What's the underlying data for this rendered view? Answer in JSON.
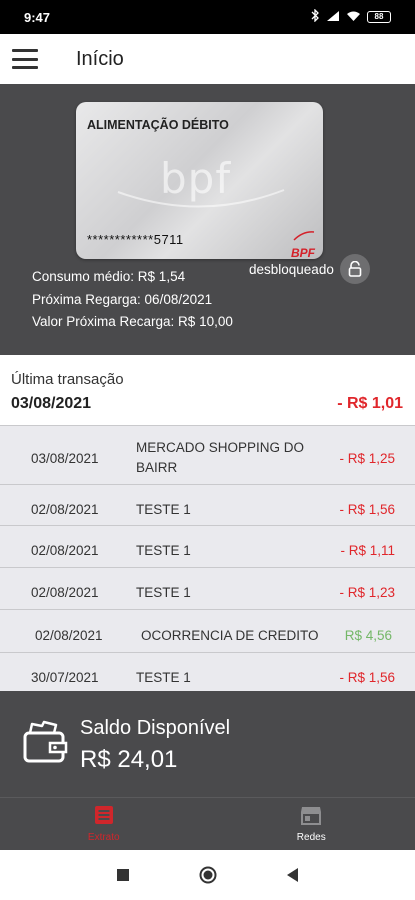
{
  "status_bar": {
    "time": "9:47",
    "battery": "88"
  },
  "app_bar": {
    "title": "Início"
  },
  "card": {
    "title": "ALIMENTAÇÃO DÉBITO",
    "watermark": "bpf",
    "number": "************5711",
    "brand": "BPF",
    "info": [
      "Consumo médio: R$ 1,54",
      "Próxima Regarga: 06/08/2021",
      "Valor Próxima Recarga: R$ 10,00"
    ],
    "lock_status": "desbloqueado"
  },
  "last_transaction": {
    "label": "Última transação",
    "date": "03/08/2021",
    "amount": "- R$ 1,01"
  },
  "transactions": [
    {
      "date": "03/08/2021",
      "description": "MERCADO SHOPPING DO BAIRR",
      "amount": "- R$ 1,25"
    },
    {
      "date": "02/08/2021",
      "description": "TESTE 1",
      "amount": "- R$ 1,56"
    },
    {
      "date": "02/08/2021",
      "description": "TESTE 1",
      "amount": "- R$ 1,11"
    },
    {
      "date": "02/08/2021",
      "description": "TESTE 1",
      "amount": "- R$ 1,23"
    },
    {
      "date": "02/08/2021",
      "description": "OCORRENCIA DE CREDITO",
      "amount": "R$ 4,56"
    },
    {
      "date": "30/07/2021",
      "description": "TESTE 1",
      "amount": "- R$ 1,56"
    }
  ],
  "balance": {
    "label": "Saldo Disponível",
    "value": "R$ 24,01"
  },
  "bottom_nav": {
    "items": [
      {
        "label": "Extrato",
        "icon": "statement-icon"
      },
      {
        "label": "Redes",
        "icon": "store-icon"
      }
    ]
  },
  "colors": {
    "accent": "#d0262b",
    "negative": "#e0262b",
    "positive": "#74b767",
    "dark_panel": "#4a4a4c"
  }
}
